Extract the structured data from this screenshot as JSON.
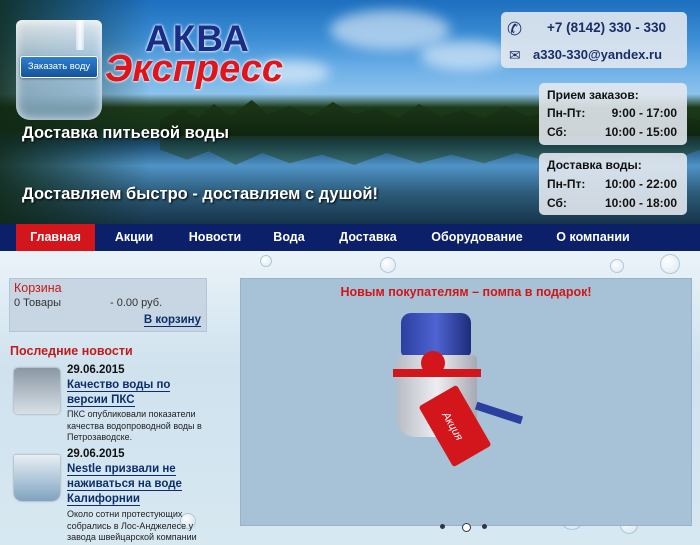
{
  "header": {
    "order_button": "Заказать воду",
    "logo_line1": "АКВА",
    "logo_line2": "Экспресс",
    "tagline1": "Доставка питьевой воды",
    "tagline2": "Доставляем быстро - доставляем с душой!",
    "phone": "+7 (8142) 330 - 330",
    "email": "a330-330@yandex.ru",
    "phone_icon": "phone-icon",
    "mail_icon": "mail-icon",
    "orders": {
      "title": "Прием заказов:",
      "rows": [
        {
          "days": "Пн-Пт:",
          "time": "9:00 - 17:00"
        },
        {
          "days": "Сб:",
          "time": "10:00 - 15:00"
        }
      ]
    },
    "delivery": {
      "title": "Доставка воды:",
      "rows": [
        {
          "days": "Пн-Пт:",
          "time": "10:00 - 22:00"
        },
        {
          "days": "Сб:",
          "time": "10:00 - 18:00"
        }
      ]
    }
  },
  "nav": {
    "items": [
      "Главная",
      "Акции",
      "Новости",
      "Вода",
      "Доставка",
      "Оборудование",
      "О компании"
    ],
    "active_index": 0
  },
  "cart": {
    "title": "Корзина",
    "count": "0 Товары",
    "sum": "-  0.00 руб.",
    "link": "В корзину"
  },
  "news": {
    "heading": "Последние новости",
    "items": [
      {
        "date": "29.06.2015",
        "title": "Качество воды по версии ПКС",
        "text": "ПКС опубликовали показатели качества водопроводной воды в Петрозаводске."
      },
      {
        "date": "29.06.2015",
        "title": "Nestle призвали не наживаться на воде Калифорнии",
        "text": "Около сотни протестующих собрались в Лос-Анджелесе у завода швейцарской компании Nestle по производству"
      }
    ]
  },
  "promo": {
    "title": "Новым покупателям – помпа в подарок!",
    "tag_text": "Акция",
    "slides_count": 3,
    "active_slide": 1
  },
  "colors": {
    "nav_bg": "#0b2068",
    "accent_red": "#d3161b",
    "link_blue": "#0d2e6c"
  }
}
